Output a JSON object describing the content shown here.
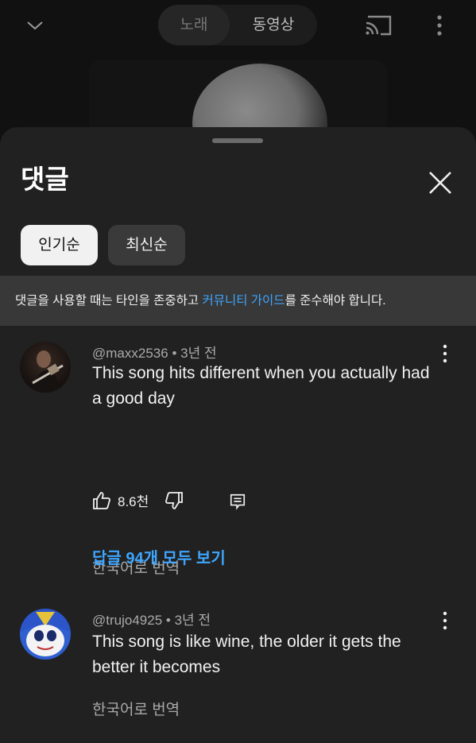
{
  "header": {
    "toggle": {
      "song_label": "노래",
      "video_label": "동영상",
      "selected": "동영상"
    },
    "icons": [
      "chevron-down-icon",
      "cast-icon",
      "more-vert-icon"
    ]
  },
  "comments_panel": {
    "title": "댓글",
    "sort_chips": [
      {
        "label": "인기순",
        "selected": true
      },
      {
        "label": "최신순",
        "selected": false
      }
    ],
    "notice": {
      "prefix": "댓글을 사용할 때는 타인을 존중하고 ",
      "link": "커뮤니티 가이드",
      "suffix": "를 준수해야 합니다."
    },
    "comments": [
      {
        "author": "@maxx2536",
        "age": "3년 전",
        "text": "This song hits different when you actually had a good day",
        "translate_label": "한국어로 번역",
        "likes": "8.6천",
        "replies_label": "답글 94개 모두 보기"
      },
      {
        "author": "@trujo4925",
        "age": "3년 전",
        "text": "This song is like wine, the older it gets the better it becomes",
        "translate_label": "한국어로 번역"
      }
    ]
  },
  "colors": {
    "background": "#0f0f0f",
    "sheet": "#212121",
    "notice_bg": "#383838",
    "link": "#3ea6ff",
    "secondary_text": "#aaaaaa"
  }
}
